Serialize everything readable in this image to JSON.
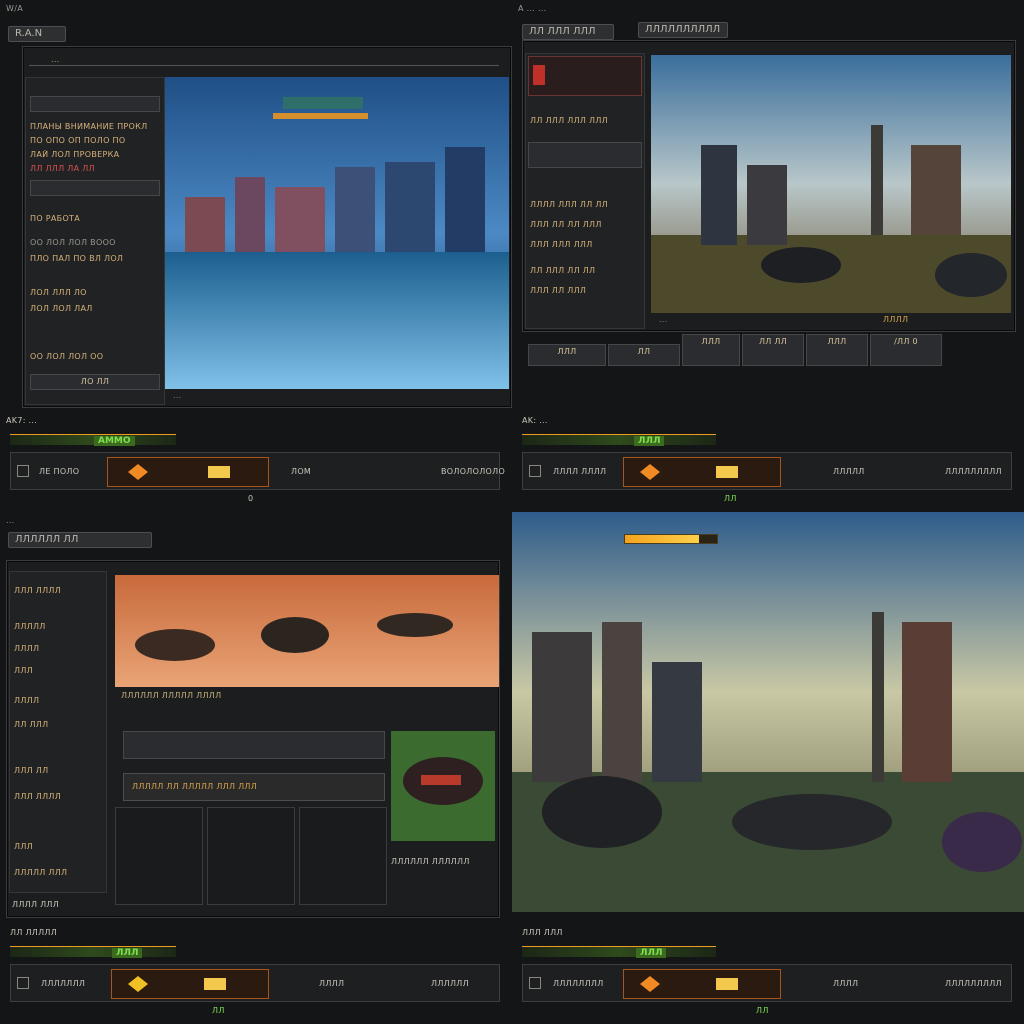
{
  "colors": {
    "accent_orange": "#f4a31e",
    "hud_green": "#7fe04f",
    "alert_red": "#d9534f",
    "panel_bg": "#1c1d1f"
  },
  "q1": {
    "topbar": "W/A",
    "tab_label": "R.A.N",
    "address_text": "...",
    "sidebar": {
      "rows": [
        "ПЛАНЫ ВНИМАНИЕ ПРОКЛ",
        "ПО ОПО ОП ПОЛО ПО",
        "ЛАЙ ЛОЛ ПРОВЕРКА",
        "ЛЛ ЛЛЛ ЛА ЛЛ",
        "ПО РАБОТА",
        "ОО ЛОЛ ЛОЛ ВООО",
        "ПЛО ПАЛ ПО ВЛ ЛОЛ",
        "ЛОЛ ЛЛЛ ЛО",
        "ЛОЛ ЛОЛ ЛАЛ",
        "ОО ЛОЛ ЛОЛ ОО"
      ],
      "footer": "ЛО ЛЛ"
    },
    "status_text": "...",
    "hud": {
      "tag": "AK7: ...",
      "bar_label": "AMMO",
      "slot_label": "ЛЕ ПОЛО",
      "slot2": "ЛОМ",
      "right_label": "ВОЛОЛОЛОЛО",
      "pager": "0"
    }
  },
  "q2": {
    "topbar": "A ... ...",
    "tab1": "ЛЛ ЛЛЛ ЛЛЛ",
    "tab2": "ЛЛЛЛЛЛЛЛЛЛ",
    "sidebar_rows": [
      "ЛЛ ЛЛЛ ЛЛЛ ЛЛЛ",
      "ЛЛЛЛ ЛЛЛ ЛЛ ЛЛ",
      "ЛЛЛ ЛЛ ЛЛ ЛЛЛ",
      "ЛЛЛ ЛЛЛ ЛЛЛ",
      "ЛЛ ЛЛЛ ЛЛ ЛЛ",
      "ЛЛЛ ЛЛ ЛЛЛ"
    ],
    "caption": "...",
    "caption_right": "ЛЛЛЛ",
    "toolbar": [
      "ЛЛЛ",
      "ЛЛ",
      "ЛЛЛ",
      "ЛЛ ЛЛ",
      "ЛЛЛ",
      "/ЛЛ 0"
    ],
    "hud": {
      "tag": "AK: ...",
      "bar_label": "ЛЛЛ",
      "slot_label": "ЛЛЛЛ ЛЛЛЛ",
      "slot2": "ЛЛЛЛЛ",
      "right_label": "ЛЛЛЛЛЛЛЛЛ",
      "pager": "ЛЛ"
    }
  },
  "q3": {
    "topbar": "...",
    "header": "ЛЛЛЛЛЛ ЛЛ",
    "sidebar_rows": [
      "ЛЛЛ ЛЛЛЛ",
      "ЛЛЛЛЛ",
      "ЛЛЛЛ",
      "ЛЛЛ",
      "ЛЛЛЛ",
      "ЛЛ ЛЛЛ",
      "ЛЛЛ ЛЛ",
      "ЛЛЛ ЛЛЛЛ",
      "ЛЛЛ",
      "ЛЛЛЛЛ ЛЛЛ"
    ],
    "banner_caption": "ЛЛЛЛЛЛ ЛЛЛЛЛ ЛЛЛЛ",
    "title_strip": "ЛЛЛЛЛ ЛЛ ЛЛЛЛЛ ЛЛЛ ЛЛЛ",
    "side_caption": "ЛЛЛЛЛЛ ЛЛЛЛЛЛ",
    "footer_left": "ЛЛЛЛ ЛЛЛ",
    "hud": {
      "tag": "ЛЛ ЛЛЛЛЛ",
      "bar_label": "ЛЛЛ",
      "slot_label": "ЛЛЛЛЛЛЛ",
      "slot2": "ЛЛЛЛ",
      "right_label": "ЛЛЛЛЛЛ",
      "pager": "ЛЛ"
    }
  },
  "q4": {
    "progress_value": 0.8,
    "hud": {
      "tag": "ЛЛЛ ЛЛЛ",
      "bar_label": "ЛЛЛ",
      "slot_label": "ЛЛЛЛЛЛЛЛ",
      "slot2": "ЛЛЛЛ",
      "right_label": "ЛЛЛЛЛЛЛЛЛ",
      "pager": "ЛЛ"
    }
  }
}
